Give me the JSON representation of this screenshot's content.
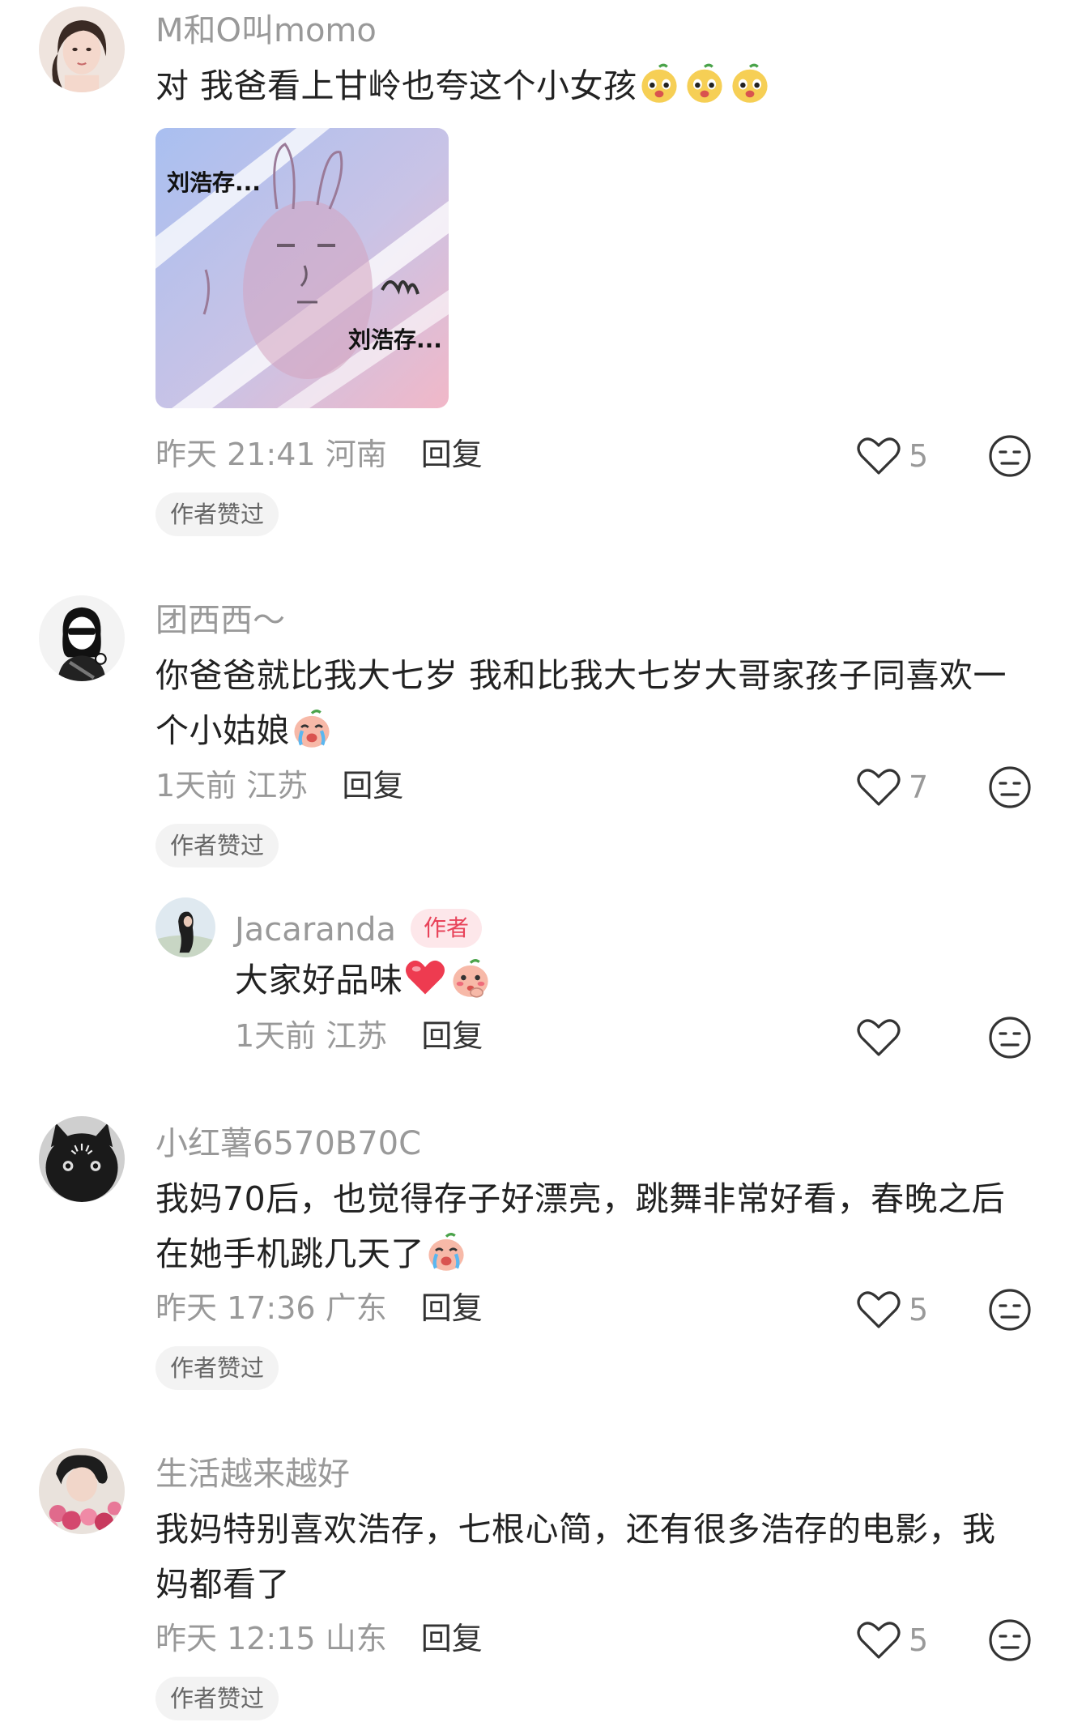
{
  "comments": [
    {
      "username": "M和O叫momo",
      "text": "对 我爸看上甘岭也夸这个小女孩",
      "emojis": [
        "pear-face-emoji",
        "pear-face-emoji",
        "pear-face-emoji"
      ],
      "sticker": {
        "text_top": "刘浩存...",
        "text_bottom": "刘浩存..."
      },
      "time": "昨天 21:41",
      "location": "河南",
      "reply_label": "回复",
      "likes": "5",
      "badge": "作者赞过"
    },
    {
      "username": "团西西～",
      "text_line1": "你爸爸就比我大七岁 我和比我大七岁大哥家孩子同喜欢一",
      "text_line2": "个小姑娘",
      "emojis": [
        "crying-peach-emoji"
      ],
      "time": "1天前",
      "location": "江苏",
      "reply_label": "回复",
      "likes": "7",
      "badge": "作者赞过",
      "reply": {
        "username": "Jacaranda",
        "author_tag": "作者",
        "text": "大家好品味",
        "emojis": [
          "red-heart-emoji",
          "shy-peach-emoji"
        ],
        "time": "1天前",
        "location": "江苏",
        "reply_label": "回复"
      }
    },
    {
      "username": "小红薯6570B70C",
      "text_line1": "我妈70后，也觉得存子好漂亮，跳舞非常好看，春晚之后",
      "text_line2": "在她手机跳几天了",
      "emojis": [
        "crying-peach-emoji"
      ],
      "time": "昨天 17:36",
      "location": "广东",
      "reply_label": "回复",
      "likes": "5",
      "badge": "作者赞过"
    },
    {
      "username": "生活越来越好",
      "text_line1": "我妈特别喜欢浩存，七根心简，还有很多浩存的电影，我",
      "text_line2": "妈都看了",
      "time": "昨天 12:15",
      "location": "山东",
      "reply_label": "回复",
      "likes": "5",
      "badge": "作者赞过"
    }
  ],
  "colors": {
    "muted_text": "#999999",
    "body_text": "#222222",
    "author_tag_bg": "#fde7ea",
    "author_tag_text": "#e8435a",
    "badge_bg": "#f3f3f3"
  }
}
